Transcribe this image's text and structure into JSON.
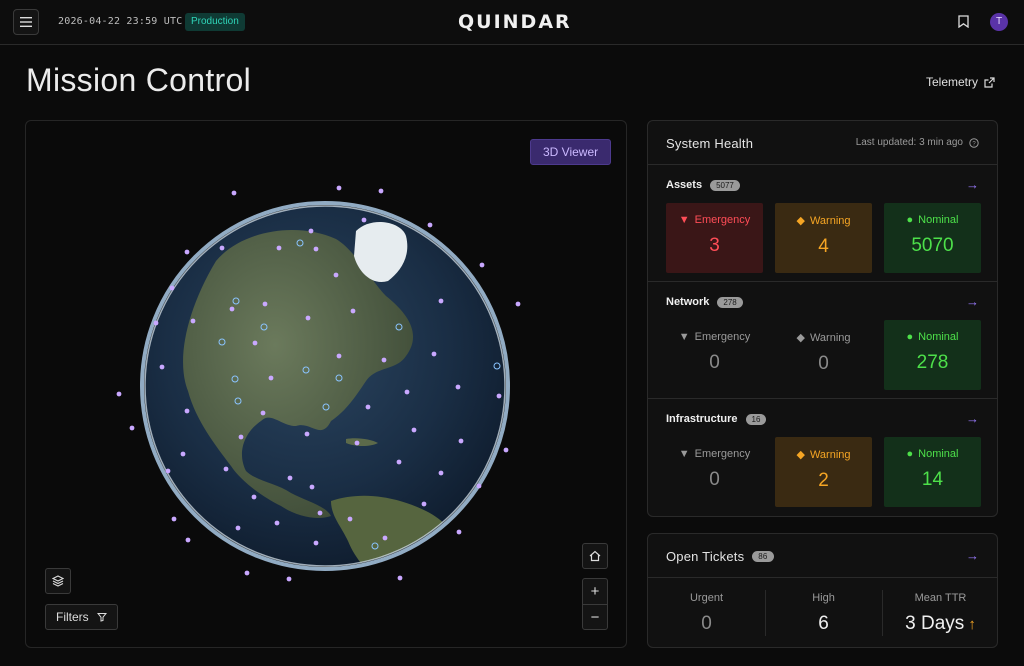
{
  "topbar": {
    "datetime": "2026-04-22 23:59 UTC",
    "environment": "Production",
    "logo": "QUINDAR",
    "avatar_initial": "T"
  },
  "page": {
    "title": "Mission Control",
    "telemetry_link": "Telemetry"
  },
  "map": {
    "viewer_button": "3D Viewer",
    "filters_button": "Filters",
    "zoom_in": "+",
    "zoom_out": "−"
  },
  "health": {
    "title": "System Health",
    "last_updated": "Last updated: 3 min ago",
    "sections": [
      {
        "label": "Assets",
        "count": "5077",
        "tiles": [
          {
            "label": "Emergency",
            "value": "3"
          },
          {
            "label": "Warning",
            "value": "4"
          },
          {
            "label": "Nominal",
            "value": "5070"
          }
        ]
      },
      {
        "label": "Network",
        "count": "278",
        "tiles": [
          {
            "label": "Emergency",
            "value": "0"
          },
          {
            "label": "Warning",
            "value": "0"
          },
          {
            "label": "Nominal",
            "value": "278"
          }
        ]
      },
      {
        "label": "Infrastructure",
        "count": "16",
        "tiles": [
          {
            "label": "Emergency",
            "value": "0"
          },
          {
            "label": "Warning",
            "value": "2"
          },
          {
            "label": "Nominal",
            "value": "14"
          }
        ]
      }
    ]
  },
  "tickets": {
    "title": "Open Tickets",
    "count": "86",
    "columns": [
      {
        "label": "Urgent",
        "value": "0"
      },
      {
        "label": "High",
        "value": "6"
      },
      {
        "label": "Mean TTR",
        "value": "3 Days"
      }
    ]
  },
  "colors": {
    "emergency": "#ff4d57",
    "warning": "#f5a524",
    "nominal": "#4de04a",
    "accent": "#9b7bff",
    "env_badge": "#2fd4b8"
  }
}
